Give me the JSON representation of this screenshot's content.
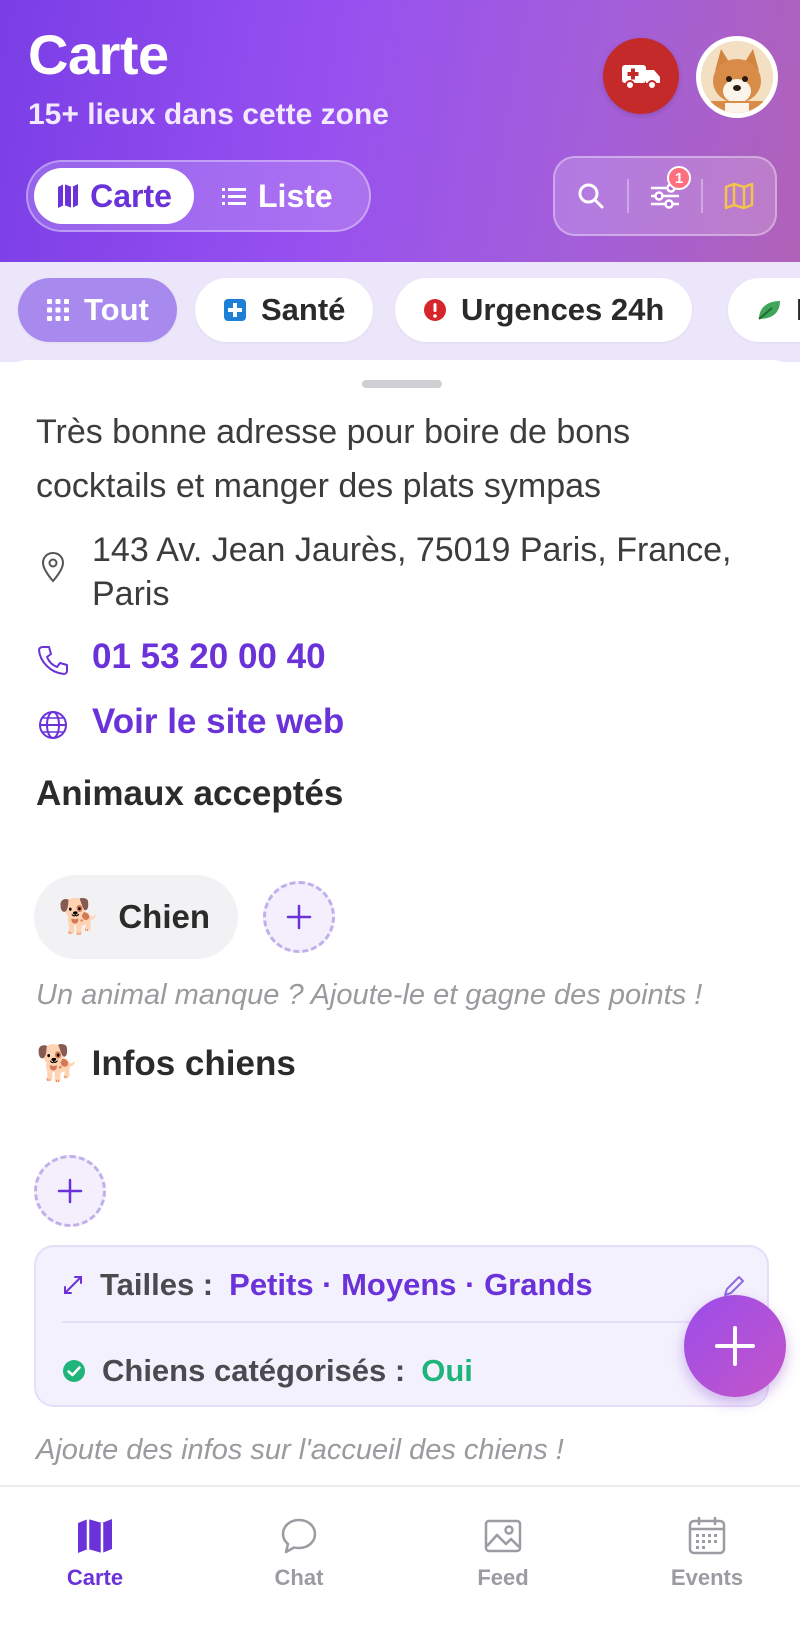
{
  "header": {
    "title": "Carte",
    "subtitle": "15+ lieux dans cette zone",
    "view_toggle": {
      "map_label": "Carte",
      "list_label": "Liste",
      "selected": "Carte"
    },
    "filter_badge": "1"
  },
  "categories": [
    {
      "label": "Tout",
      "icon": "grid-icon",
      "active": true
    },
    {
      "label": "Santé",
      "icon": "medical-cross-icon",
      "active": false
    },
    {
      "label": "Urgences 24h",
      "icon": "alert-icon",
      "active": false
    },
    {
      "label": "I",
      "icon": "leaf-icon",
      "active": false
    }
  ],
  "place": {
    "description": "Très bonne adresse pour boire de bons cocktails et manger des plats sympas",
    "address": "143 Av. Jean Jaurès, 75019 Paris, France, Paris",
    "phone": "01 53 20 00 40",
    "website_label": "Voir le site web"
  },
  "animals": {
    "title": "Animaux acceptés",
    "accepted": [
      {
        "emoji": "🐕",
        "label": "Chien"
      }
    ],
    "hint": "Un animal manque ? Ajoute-le et gagne des points !"
  },
  "dog_info": {
    "title": "Infos chiens",
    "emoji": "🐕",
    "sizes_label": "Tailles :",
    "sizes_value": "Petits · Moyens · Grands",
    "categorized_label": "Chiens catégorisés :",
    "categorized_value": "Oui",
    "hint": "Ajoute des infos sur l'accueil des chiens !"
  },
  "tabs": [
    {
      "label": "Carte",
      "icon": "map-icon",
      "active": true
    },
    {
      "label": "Chat",
      "icon": "chat-icon",
      "active": false
    },
    {
      "label": "Feed",
      "icon": "image-icon",
      "active": false
    },
    {
      "label": "Events",
      "icon": "calendar-icon",
      "active": false
    }
  ],
  "colors": {
    "accent": "#6a32d8",
    "emergency": "#c42a2a",
    "success": "#1fb47a",
    "header_gradient_start": "#7a3ee6",
    "header_gradient_end": "#b062b8"
  }
}
